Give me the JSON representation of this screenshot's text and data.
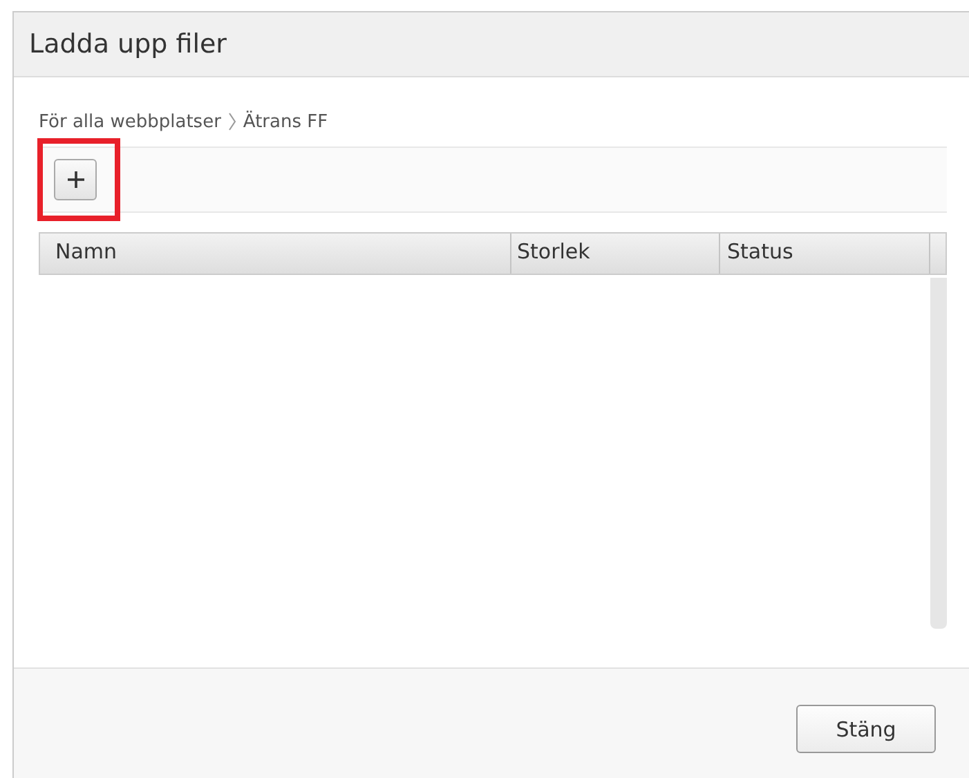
{
  "window": {
    "title": "Ladda upp filer"
  },
  "breadcrumb": [
    "För alla webbplatser",
    "Ätrans FF"
  ],
  "toolbar": {
    "highlighted": true
  },
  "table": {
    "columns": [
      "Namn",
      "Storlek",
      "Status"
    ]
  },
  "buttons": [
    "Stäng"
  ]
}
